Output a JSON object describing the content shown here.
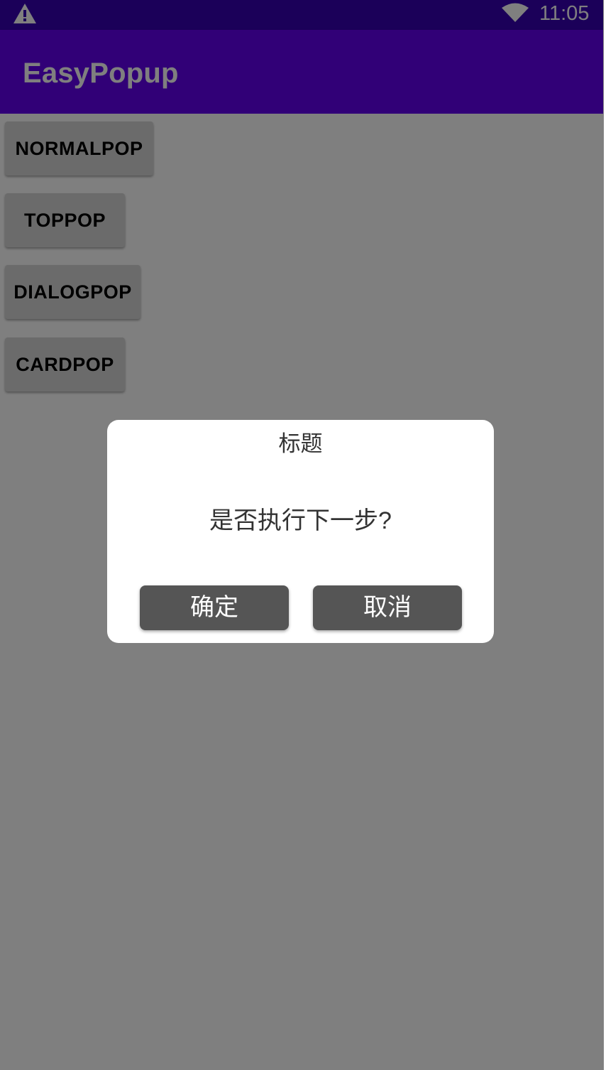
{
  "status_bar": {
    "time": "11:05",
    "icons": [
      "alert-triangle-icon",
      "wifi-icon"
    ]
  },
  "app_bar": {
    "title": "EasyPopup"
  },
  "buttons": {
    "normal_pop": "NORMALPOP",
    "top_pop": "TOPPOP",
    "dialog_pop": "DIALOGPOP",
    "card_pop": "CARDPOP"
  },
  "dialog": {
    "title": "标题",
    "message": "是否执行下一步?",
    "confirm_label": "确定",
    "cancel_label": "取消"
  },
  "colors": {
    "status_bar": "#3700B3",
    "app_bar": "#6200EE",
    "button_bg": "#d6d7d7",
    "dialog_button_bg": "#555555",
    "scrim": "rgba(0,0,0,0.5)"
  }
}
